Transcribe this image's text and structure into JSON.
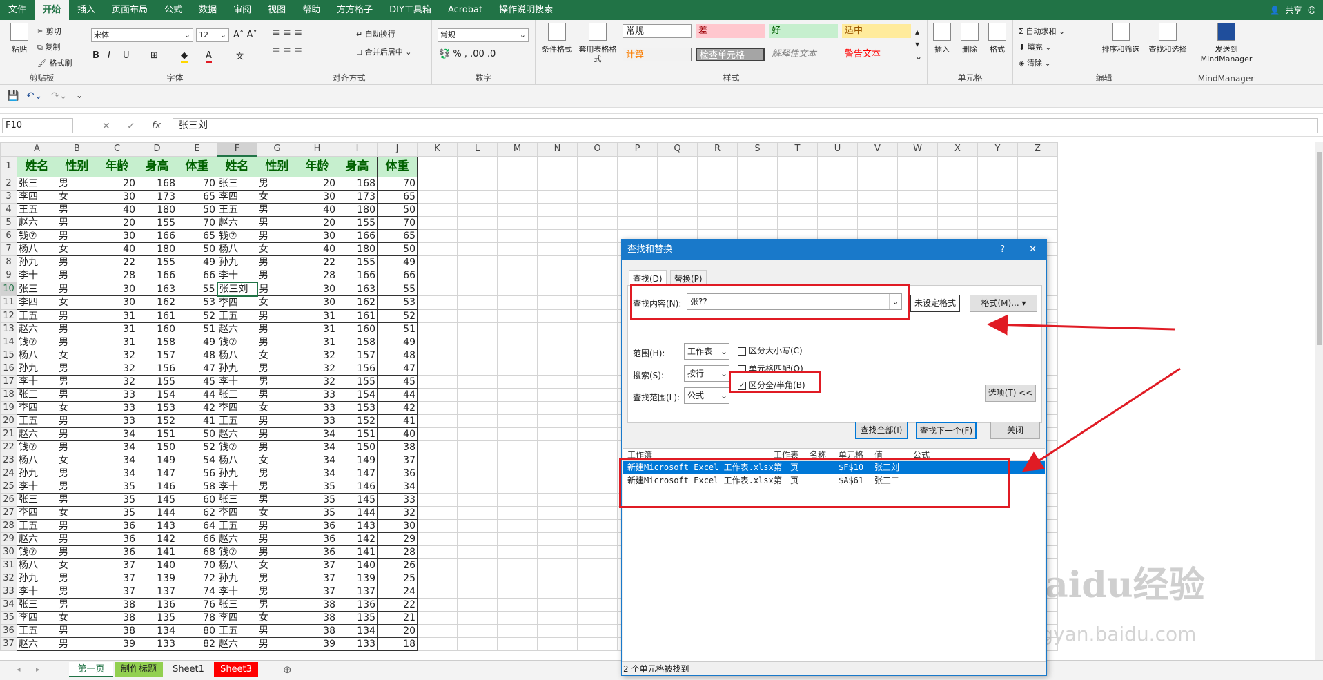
{
  "menu": {
    "items": [
      "文件",
      "开始",
      "插入",
      "页面布局",
      "公式",
      "数据",
      "审阅",
      "视图",
      "帮助",
      "方方格子",
      "DIY工具箱",
      "Acrobat",
      "操作说明搜索"
    ],
    "share": "共享"
  },
  "ribbon": {
    "clipboard": {
      "label": "剪贴板",
      "paste": "粘贴",
      "cut": "剪切",
      "copy": "复制",
      "painter": "格式刷"
    },
    "font": {
      "label": "字体",
      "name": "宋体",
      "size": "12"
    },
    "align": {
      "label": "对齐方式",
      "wrap": "自动换行",
      "merge": "合并后居中"
    },
    "number": {
      "label": "数字",
      "format": "常规"
    },
    "styles": {
      "label": "样式",
      "cond": "条件格式",
      "table": "套用表格格式",
      "cells": [
        "常规",
        "差",
        "好",
        "适中",
        "计算",
        "检查单元格",
        "解释性文本",
        "警告文本"
      ]
    },
    "cells": {
      "label": "单元格",
      "insert": "插入",
      "delete": "删除",
      "format": "格式"
    },
    "edit": {
      "label": "编辑",
      "autosum": "自动求和",
      "fill": "填充",
      "clear": "清除",
      "sort": "排序和筛选",
      "find": "查找和选择"
    },
    "mind": {
      "label": "MindManager",
      "send": "发送到 MindManager"
    }
  },
  "formula": {
    "namebox": "F10",
    "content": "张三刘"
  },
  "columns": [
    "A",
    "B",
    "C",
    "D",
    "E",
    "F",
    "G",
    "H",
    "I",
    "J",
    "K",
    "L",
    "M",
    "N",
    "O",
    "P",
    "Q",
    "R",
    "S",
    "T",
    "U",
    "V",
    "W",
    "X",
    "Y",
    "Z"
  ],
  "headers": [
    "姓名",
    "性别",
    "年龄",
    "身高",
    "体重",
    "姓名",
    "性别",
    "年龄",
    "身高",
    "体重"
  ],
  "rows": [
    [
      "张三",
      "男",
      20,
      168,
      70,
      "张三",
      "男",
      20,
      168,
      70
    ],
    [
      "李四",
      "女",
      30,
      173,
      65,
      "李四",
      "女",
      30,
      173,
      65
    ],
    [
      "王五",
      "男",
      40,
      180,
      50,
      "王五",
      "男",
      40,
      180,
      50
    ],
    [
      "赵六",
      "男",
      20,
      155,
      70,
      "赵六",
      "男",
      20,
      155,
      70
    ],
    [
      "钱⑦",
      "男",
      30,
      166,
      65,
      "钱⑦",
      "男",
      30,
      166,
      65
    ],
    [
      "杨八",
      "女",
      40,
      180,
      50,
      "杨八",
      "女",
      40,
      180,
      50
    ],
    [
      "孙九",
      "男",
      22,
      155,
      49,
      "孙九",
      "男",
      22,
      155,
      49
    ],
    [
      "李十",
      "男",
      28,
      166,
      66,
      "李十",
      "男",
      28,
      166,
      66
    ],
    [
      "张三",
      "男",
      30,
      163,
      55,
      "张三刘",
      "男",
      30,
      163,
      55
    ],
    [
      "李四",
      "女",
      30,
      162,
      53,
      "李四",
      "女",
      30,
      162,
      53
    ],
    [
      "王五",
      "男",
      31,
      161,
      52,
      "王五",
      "男",
      31,
      161,
      52
    ],
    [
      "赵六",
      "男",
      31,
      160,
      51,
      "赵六",
      "男",
      31,
      160,
      51
    ],
    [
      "钱⑦",
      "男",
      31,
      158,
      49,
      "钱⑦",
      "男",
      31,
      158,
      49
    ],
    [
      "杨八",
      "女",
      32,
      157,
      48,
      "杨八",
      "女",
      32,
      157,
      48
    ],
    [
      "孙九",
      "男",
      32,
      156,
      47,
      "孙九",
      "男",
      32,
      156,
      47
    ],
    [
      "李十",
      "男",
      32,
      155,
      45,
      "李十",
      "男",
      32,
      155,
      45
    ],
    [
      "张三",
      "男",
      33,
      154,
      44,
      "张三",
      "男",
      33,
      154,
      44
    ],
    [
      "李四",
      "女",
      33,
      153,
      42,
      "李四",
      "女",
      33,
      153,
      42
    ],
    [
      "王五",
      "男",
      33,
      152,
      41,
      "王五",
      "男",
      33,
      152,
      41
    ],
    [
      "赵六",
      "男",
      34,
      151,
      50,
      "赵六",
      "男",
      34,
      151,
      40
    ],
    [
      "钱⑦",
      "男",
      34,
      150,
      52,
      "钱⑦",
      "男",
      34,
      150,
      38
    ],
    [
      "杨八",
      "女",
      34,
      149,
      54,
      "杨八",
      "女",
      34,
      149,
      37
    ],
    [
      "孙九",
      "男",
      34,
      147,
      56,
      "孙九",
      "男",
      34,
      147,
      36
    ],
    [
      "李十",
      "男",
      35,
      146,
      58,
      "李十",
      "男",
      35,
      146,
      34
    ],
    [
      "张三",
      "男",
      35,
      145,
      60,
      "张三",
      "男",
      35,
      145,
      33
    ],
    [
      "李四",
      "女",
      35,
      144,
      62,
      "李四",
      "女",
      35,
      144,
      32
    ],
    [
      "王五",
      "男",
      36,
      143,
      64,
      "王五",
      "男",
      36,
      143,
      30
    ],
    [
      "赵六",
      "男",
      36,
      142,
      66,
      "赵六",
      "男",
      36,
      142,
      29
    ],
    [
      "钱⑦",
      "男",
      36,
      141,
      68,
      "钱⑦",
      "男",
      36,
      141,
      28
    ],
    [
      "杨八",
      "女",
      37,
      140,
      70,
      "杨八",
      "女",
      37,
      140,
      26
    ],
    [
      "孙九",
      "男",
      37,
      139,
      72,
      "孙九",
      "男",
      37,
      139,
      25
    ],
    [
      "李十",
      "男",
      37,
      137,
      74,
      "李十",
      "男",
      37,
      137,
      24
    ],
    [
      "张三",
      "男",
      38,
      136,
      76,
      "张三",
      "男",
      38,
      136,
      22
    ],
    [
      "李四",
      "女",
      38,
      135,
      78,
      "李四",
      "女",
      38,
      135,
      21
    ],
    [
      "王五",
      "男",
      38,
      134,
      80,
      "王五",
      "男",
      38,
      134,
      20
    ],
    [
      "赵六",
      "男",
      39,
      133,
      82,
      "赵六",
      "男",
      39,
      133,
      18
    ]
  ],
  "sheets": [
    "第一页",
    "制作标题",
    "Sheet1",
    "Sheet3"
  ],
  "dialog": {
    "title": "查找和替换",
    "help": "?",
    "close": "✕",
    "tab_find": "查找(D)",
    "tab_replace": "替换(P)",
    "find_label": "查找内容(N):",
    "find_value": "张??",
    "noformat": "未设定格式",
    "format_btn": "格式(M)...",
    "within_label": "范围(H):",
    "within_value": "工作表",
    "search_label": "搜索(S):",
    "search_value": "按行",
    "lookin_label": "查找范围(L):",
    "lookin_value": "公式",
    "opt_case": "区分大小写(C)",
    "opt_cell": "单元格匹配(O)",
    "opt_width": "区分全/半角(B)",
    "options_btn": "选项(T) <<",
    "find_all": "查找全部(I)",
    "find_next": "查找下一个(F)",
    "close_btn": "关闭",
    "result_headers": [
      "工作簿",
      "工作表",
      "名称",
      "单元格",
      "值",
      "公式"
    ],
    "results": [
      {
        "book": "新建Microsoft Excel 工作表.xlsx",
        "sheet": "第一页",
        "cell": "$F$10",
        "value": "张三刘"
      },
      {
        "book": "新建Microsoft Excel 工作表.xlsx",
        "sheet": "第一页",
        "cell": "$A$61",
        "value": "张三二"
      }
    ],
    "status": "2 个单元格被找到"
  },
  "watermark": {
    "brand": "Baidu经验",
    "url": "jingyan.baidu.com"
  },
  "colors": {
    "excel_green": "#217346",
    "header_fill": "#c6efce",
    "dialog_blue": "#1979ca",
    "annotation_red": "#e01b24",
    "selected_row": "#0078d7"
  }
}
